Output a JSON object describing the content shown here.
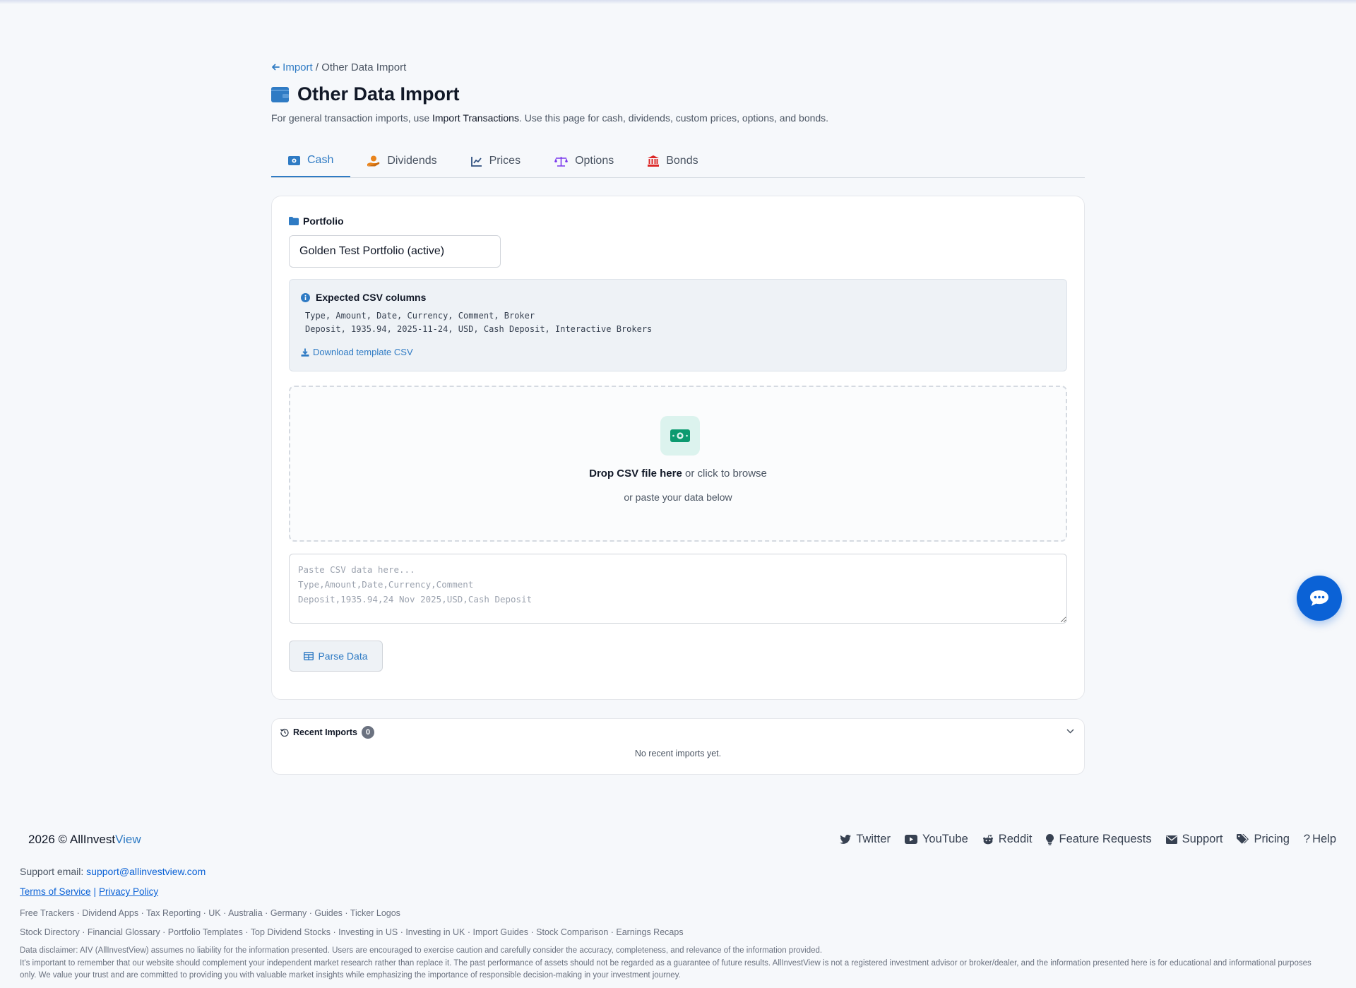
{
  "breadcrumb": {
    "back_link": "Import",
    "separator": "/",
    "current": "Other Data Import"
  },
  "page": {
    "title": "Other Data Import",
    "subtitle_prefix": "For general transaction imports, use ",
    "subtitle_link": "Import Transactions",
    "subtitle_suffix": ". Use this page for cash, dividends, custom prices, options, and bonds."
  },
  "tabs": [
    {
      "label": "Cash",
      "icon": "money-icon",
      "active": true
    },
    {
      "label": "Dividends",
      "icon": "hand-coins-icon",
      "active": false
    },
    {
      "label": "Prices",
      "icon": "line-chart-icon",
      "active": false
    },
    {
      "label": "Options",
      "icon": "scale-icon",
      "active": false
    },
    {
      "label": "Bonds",
      "icon": "bank-icon",
      "active": false
    }
  ],
  "portfolio": {
    "label": "Portfolio",
    "selected": "Golden Test Portfolio (active)"
  },
  "expected": {
    "title": "Expected CSV columns",
    "header_line": "Type, Amount, Date, Currency, Comment, Broker",
    "example_line": "Deposit, 1935.94, 2025-11-24, USD, Cash Deposit, Interactive Brokers",
    "download_label": "Download template CSV"
  },
  "dropzone": {
    "bold": "Drop CSV file here",
    "rest": " or click to browse",
    "sub": "or paste your data below"
  },
  "paste": {
    "placeholder": "Paste CSV data here...\nType,Amount,Date,Currency,Comment\nDeposit,1935.94,24 Nov 2025,USD,Cash Deposit"
  },
  "parse_button": "Parse Data",
  "recent": {
    "title": "Recent Imports",
    "count": "0",
    "empty": "No recent imports yet."
  },
  "footer": {
    "copyright": "2026 © ",
    "brand_a": "AllInvest",
    "brand_b": "View",
    "links": [
      {
        "label": "Twitter",
        "icon": "twitter-icon"
      },
      {
        "label": "YouTube",
        "icon": "youtube-icon"
      },
      {
        "label": "Reddit",
        "icon": "reddit-icon"
      },
      {
        "label": "Feature Requests",
        "icon": "lightbulb-icon"
      },
      {
        "label": "Support",
        "icon": "envelope-icon"
      },
      {
        "label": "Pricing",
        "icon": "tags-icon"
      },
      {
        "label": "Help",
        "icon": "question-icon"
      }
    ],
    "support_prefix": "Support email: ",
    "support_email": "support@allinvestview.com",
    "terms": "Terms of Service",
    "privacy": "Privacy Policy",
    "seo_row1": [
      "Free Trackers",
      "Dividend Apps",
      "Tax Reporting",
      "UK",
      "Australia",
      "Germany",
      "Guides",
      "Ticker Logos"
    ],
    "seo_row2": [
      "Stock Directory",
      "Financial Glossary",
      "Portfolio Templates",
      "Top Dividend Stocks",
      "Investing in US",
      "Investing in UK",
      "Import Guides",
      "Stock Comparison",
      "Earnings Recaps"
    ],
    "disclaimer1": "Data disclaimer: AIV (AllInvestView) assumes no liability for the information presented. Users are encouraged to exercise caution and carefully consider the accuracy, completeness, and relevance of the information provided.",
    "disclaimer2": "It's important to remember that our website should complement your independent market research rather than replace it. The past performance of assets should not be regarded as a guarantee of future results. AllInvestView is not a registered investment advisor or broker/dealer, and the information presented here is for educational and informational purposes only. We value your trust and are committed to providing you with valuable market insights while emphasizing the importance of responsible decision-making in your investment journey."
  },
  "colors": {
    "accent": "#2f7bc4",
    "primary_button": "#0b62d6",
    "page_bg": "#f6f8fb"
  }
}
